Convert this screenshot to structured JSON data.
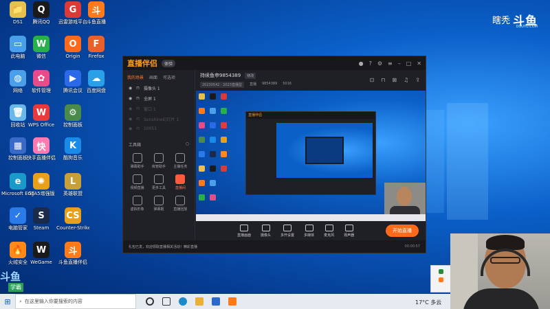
{
  "brand": {
    "text1": "瞎秃",
    "text2": "斗鱼",
    "url": "DOUYU.COM"
  },
  "desktop_icons": [
    {
      "label": "DS1",
      "color": "#e8c050",
      "glyph": "📁"
    },
    {
      "label": "腾讯QQ",
      "color": "#1a1a1a",
      "glyph": "Q"
    },
    {
      "label": "迅雷游戏平台",
      "color": "#d93a3a",
      "glyph": "G"
    },
    {
      "label": "斗鱼直播",
      "color": "#ff7a1a",
      "glyph": "斗"
    },
    {
      "label": "此电脑",
      "color": "#4aa0e8",
      "glyph": "▭"
    },
    {
      "label": "微信",
      "color": "#2ab04a",
      "glyph": "W"
    },
    {
      "label": "Origin",
      "color": "#ff6a1a",
      "glyph": "O"
    },
    {
      "label": "Firefox",
      "color": "#e8602a",
      "glyph": "F"
    },
    {
      "label": "网络",
      "color": "#4aa0e8",
      "glyph": "◍"
    },
    {
      "label": "软件管理",
      "color": "#e84a8a",
      "glyph": "✿"
    },
    {
      "label": "腾讯会议",
      "color": "#2a6ae8",
      "glyph": "▶"
    },
    {
      "label": "百度网盘",
      "color": "#2aa0e8",
      "glyph": "☁"
    },
    {
      "label": "回收站",
      "color": "#6ab8e8",
      "glyph": "🗑"
    },
    {
      "label": "WPS Office",
      "color": "#e83a3a",
      "glyph": "W"
    },
    {
      "label": "控制面板",
      "color": "#4a8a4a",
      "glyph": "⚙"
    },
    {
      "label": "控制面板",
      "color": "#3a6ac8",
      "glyph": "▦"
    },
    {
      "label": "快手直播伴侣",
      "color": "#ff7ab0",
      "glyph": "快"
    },
    {
      "label": "酷狗音乐",
      "color": "#1a8ae8",
      "glyph": "K"
    },
    {
      "label": "Microsoft Edge",
      "color": "#1a9ac8",
      "glyph": "e"
    },
    {
      "label": "GTA5增强版",
      "color": "#e8a01a",
      "glyph": "✺"
    },
    {
      "label": "英雄联盟",
      "color": "#c8a03a",
      "glyph": "L"
    },
    {
      "label": "电脑管家",
      "color": "#2a7ae8",
      "glyph": "✓"
    },
    {
      "label": "Steam",
      "color": "#1a2a4a",
      "glyph": "S"
    },
    {
      "label": "Counter-Strike 2",
      "color": "#e8a01a",
      "glyph": "CS"
    },
    {
      "label": "火绒安全",
      "color": "#ff8a1a",
      "glyph": "🔥"
    },
    {
      "label": "WeGame",
      "color": "#1a1a1a",
      "glyph": "W"
    },
    {
      "label": "斗鱼直播伴侣",
      "color": "#ff7a1a",
      "glyph": "斗"
    }
  ],
  "app": {
    "name": "直播伴侣",
    "version_badge": "体验",
    "side_tabs": [
      "我的场景",
      "画面",
      "可选项"
    ],
    "scenes": [
      {
        "label": "摄像头 1",
        "dim": false
      },
      {
        "label": "全屏 1",
        "dim": false
      },
      {
        "label": "窗口 1",
        "dim": true
      },
      {
        "label": "Sunshine幻灯片 1",
        "dim": true
      },
      {
        "label": "10051",
        "dim": true
      }
    ],
    "tools_title": "工具箱",
    "tools": [
      {
        "label": "弹幕助手",
        "hot": false
      },
      {
        "label": "房管助手",
        "hot": false
      },
      {
        "label": "主播任务",
        "hot": false
      },
      {
        "label": "视频直播",
        "hot": false
      },
      {
        "label": "更多工具",
        "hot": false
      },
      {
        "label": "直播间",
        "hot": true
      },
      {
        "label": "虚拟形象",
        "hot": false
      },
      {
        "label": "弹幕姬",
        "hot": false
      },
      {
        "label": "直播回放",
        "hot": false
      }
    ],
    "room_title": "持续鱼申9854389",
    "room_edit": "修改",
    "room_tags": [
      "20230542 · 2023直播型",
      "直播",
      "9854389",
      "5016"
    ],
    "controls": [
      "直播画面",
      "摄像头",
      "多开设置",
      "多媒体",
      "麦克风",
      "扬声器"
    ],
    "live_button": "开始直播",
    "status_notice": "礼包已发，欢迎领取直播相关活动！精彩直播",
    "timer": "00:00:57"
  },
  "taskbar": {
    "search_placeholder": "在这里输入你要搜索的内容",
    "weather": "17°C 多云"
  },
  "watermark": {
    "logo": "斗鱼",
    "tag": "学霸"
  }
}
